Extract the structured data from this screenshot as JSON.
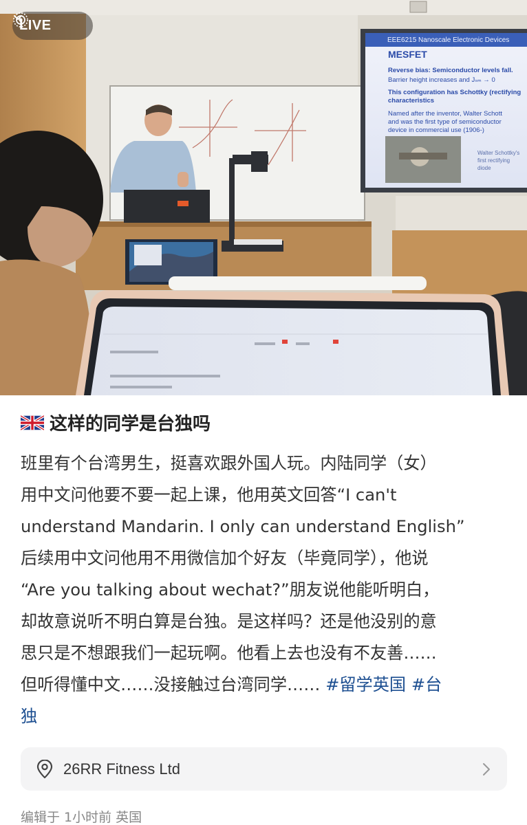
{
  "photo": {
    "live_label": "LIVE",
    "slide": {
      "course_title": "EEE6215 Nanoscale Electronic Devices",
      "heading": "MESFET",
      "lines": [
        "Reverse bias: Semiconductor levels fall.",
        "Barrier height increases and Jₛₘ → 0",
        "This configuration has Schottky (rectifying",
        "characteristics",
        "Named after the inventor, Walter Schott",
        "and was the first type of semiconductor",
        "device in commercial use (1906-)"
      ],
      "caption": "Walter Schottky's first rectifying diode"
    }
  },
  "post": {
    "title": "这样的同学是台独吗",
    "body_lines": [
      "班里有个台湾男生，挺喜欢跟外国人玩。内陆同学（女）",
      "用中文问他要不要一起上课，他用英文回答“I can't",
      "understand Mandarin. I only can understand English”",
      "后续用中文问他用不用微信加个好友（毕竟同学），他说",
      "“Are you talking about wechat?”朋友说他能听明白，",
      "却故意说听不明白算是台独。是这样吗？还是他没别的意",
      "思只是不想跟我们一起玩啊。他看上去也没有不友善……",
      "但听得懂中文……没接触过台湾同学…… "
    ],
    "hashtag1": "#留学英国",
    "hashtag2_part1": "#台",
    "hashtag2_part2": "独",
    "hashtag_color": "#1d4f91"
  },
  "location": {
    "icon": "location-pin-icon",
    "label": "26RR Fitness Ltd"
  },
  "meta": {
    "edited": "编辑于 1小时前 英国"
  }
}
